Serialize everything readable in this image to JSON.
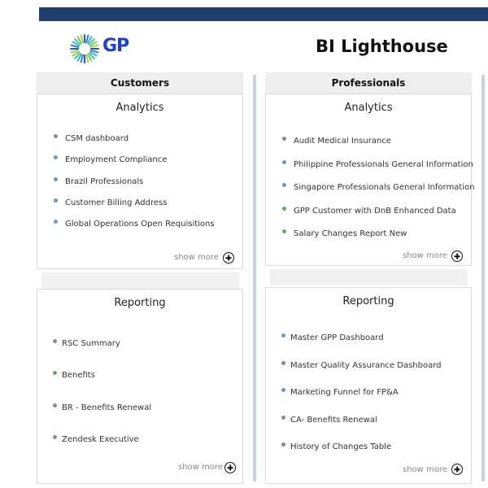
{
  "header": {
    "app_title": "BI Lighthouse",
    "logo_text": "GP"
  },
  "colors": {
    "topbar": "#1f3f6e",
    "dot_gray": "#8a8a8a",
    "dot_blue": "#6f97c6",
    "dot_green": "#5cb25c",
    "logo_blue": "#1d3fd6"
  },
  "customers": {
    "header": "Customers",
    "analytics": {
      "title": "Analytics",
      "items": [
        {
          "label": "CSM dashboard",
          "dot": "gray"
        },
        {
          "label": "Employment Compliance",
          "dot": "blue"
        },
        {
          "label": "Brazil Professionals",
          "dot": "blue"
        },
        {
          "label": "Customer Billing Address",
          "dot": "blue"
        },
        {
          "label": "Global Operations Open Requisitions",
          "dot": "blue"
        }
      ],
      "show_more": "show more"
    },
    "reporting": {
      "title": "Reporting",
      "items": [
        {
          "label": "RSC Summary",
          "dot": "gray"
        },
        {
          "label": "Benefits",
          "dot": "green"
        },
        {
          "label": "BR - Benefits Renewal",
          "dot": "gray"
        },
        {
          "label": "Zendesk Executive",
          "dot": "gray"
        }
      ],
      "show_more": "show more"
    }
  },
  "professionals": {
    "header": "Professionals",
    "analytics": {
      "title": "Analytics",
      "items": [
        {
          "label": "Audit Medical Insurance",
          "dot": "gray"
        },
        {
          "label": "Philippine Professionals General Information",
          "dot": "blue"
        },
        {
          "label": "Singapore Professionals General Information",
          "dot": "blue"
        },
        {
          "label": "GPP Customer with DnB Enhanced Data",
          "dot": "green"
        },
        {
          "label": "Salary Changes Report New",
          "dot": "green"
        }
      ],
      "show_more": "show more"
    },
    "reporting": {
      "title": "Reporting",
      "items": [
        {
          "label": "Master GPP Dashboard",
          "dot": "blue"
        },
        {
          "label": "Master Quality Assurance Dashboard",
          "dot": "gray"
        },
        {
          "label": "Marketing Funnel for FP&A",
          "dot": "blue"
        },
        {
          "label": "CA- Benefits Renewal",
          "dot": "gray"
        },
        {
          "label": "History of Changes Table",
          "dot": "gray"
        }
      ],
      "show_more": "show more"
    }
  }
}
